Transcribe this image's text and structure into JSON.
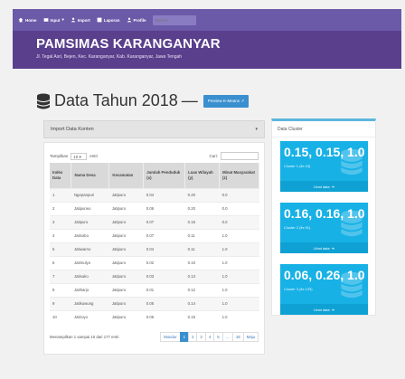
{
  "nav": {
    "items": [
      {
        "label": "Home",
        "icon": "home-icon"
      },
      {
        "label": "Input",
        "icon": "input-icon",
        "caret": "▾"
      },
      {
        "label": "Import",
        "icon": "user-icon"
      },
      {
        "label": "Laporan",
        "icon": "report-icon"
      },
      {
        "label": "Profile",
        "icon": "user-icon"
      }
    ],
    "search_placeholder": "Search"
  },
  "banner": {
    "title": "PAMSIMAS KARANGANYAR",
    "address": "Jl. Tegal Asri, Bejen, Kec. Karanganyar, Kab. Karanganyar, Jawa Tengah"
  },
  "page": {
    "title": "Data Tahun 2018",
    "dash": "—",
    "preview_button": "Preview K-Means"
  },
  "import_panel": {
    "label": "Import Data Konten",
    "caret": "▾"
  },
  "table": {
    "show_label": "Tampilkan",
    "length_value": "10",
    "entries_label": "entri",
    "search_label": "Cari:",
    "headers": [
      "Index Data",
      "Nama Desa",
      "Kecamatan",
      "Jumlah Penduduk (x)",
      "Luas Wilayah (y)",
      "Minat Masyarakat (z)"
    ],
    "rows": [
      [
        "1",
        "Ngepanpuri",
        "Jatipuro",
        "0.04",
        "0.20",
        "0.0"
      ],
      [
        "2",
        "Jatipurwo",
        "Jatipuro",
        "0.06",
        "0.20",
        "0.0"
      ],
      [
        "3",
        "Jatipuro",
        "Jatipuro",
        "0.07",
        "0.16",
        "0.0"
      ],
      [
        "4",
        "Jatisobo",
        "Jatipuro",
        "0.07",
        "0.11",
        "1.0"
      ],
      [
        "5",
        "Jatiwarno",
        "Jatipuro",
        "0.04",
        "0.11",
        "1.0"
      ],
      [
        "6",
        "Jatimulyo",
        "Jatipuro",
        "0.02",
        "0.10",
        "1.0"
      ],
      [
        "7",
        "Jatisuko",
        "Jatipuro",
        "0.03",
        "0.13",
        "1.0"
      ],
      [
        "8",
        "Jatiharjo",
        "Jatipuro",
        "0.01",
        "0.12",
        "1.0"
      ],
      [
        "9",
        "Jatikuwung",
        "Jatipuro",
        "0.05",
        "0.14",
        "1.0"
      ],
      [
        "10",
        "Jatiroyo",
        "Jatipuro",
        "0.06",
        "0.15",
        "1.0"
      ]
    ],
    "info": "Menampilkan 1 sampai 10 dari 177 entri",
    "pager": [
      "Mundur",
      "1",
      "2",
      "3",
      "4",
      "5",
      "…",
      "18",
      "Maju"
    ],
    "active_page": "1"
  },
  "cluster": {
    "title": "Data Cluster",
    "boxes": [
      {
        "value": "0.15, 0.15, 1.0",
        "label": "Cluster 1 (fix 43)",
        "more": "Lihat data"
      },
      {
        "value": "0.16, 0.16, 1.0",
        "label": "Cluster 2 (fix 91)",
        "more": "Lihat data"
      },
      {
        "value": "0.06, 0.26, 1.0",
        "label": "Cluster 3 (fix 133)",
        "more": "Lihat data"
      }
    ]
  },
  "colors": {
    "nav_bg": "#6a5aa8",
    "banner_bg": "#5a3f8c",
    "accent": "#3a8fcf",
    "cluster_box": "#17b1e6"
  }
}
